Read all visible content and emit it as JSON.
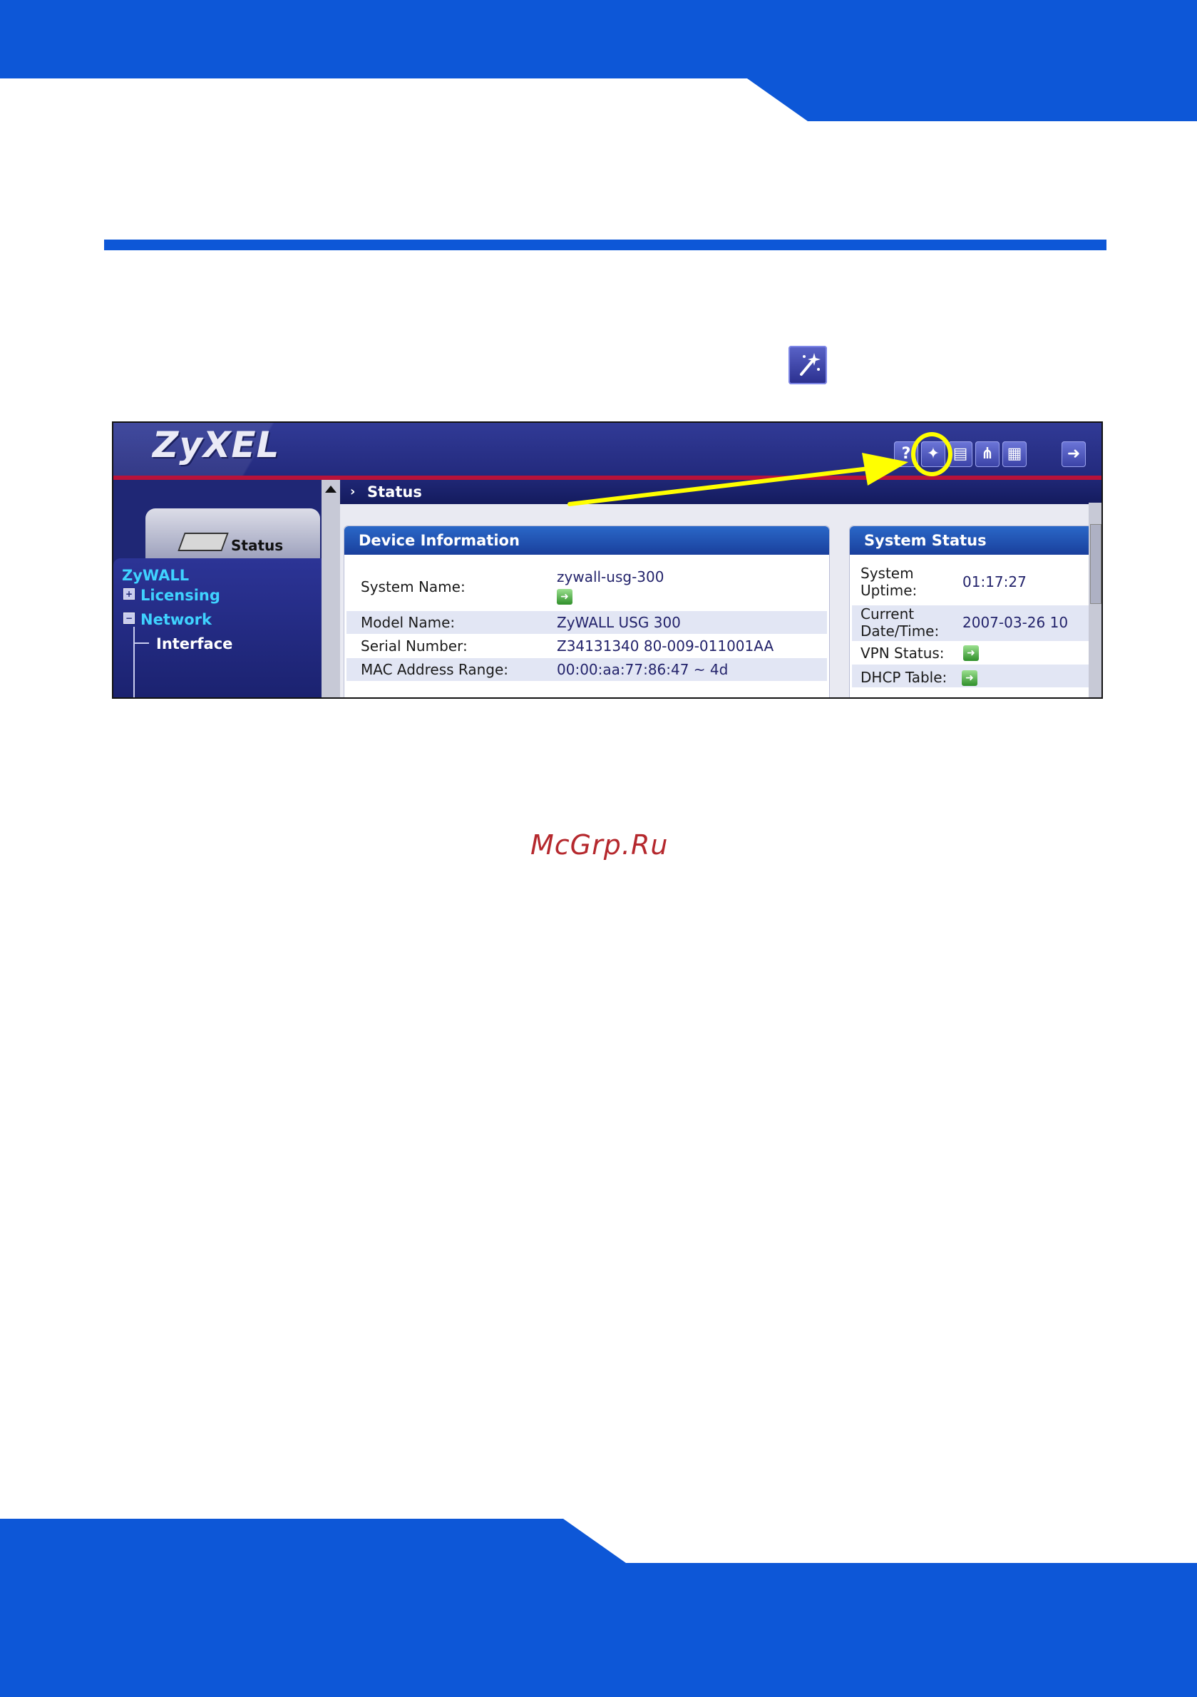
{
  "page": {
    "accent_color": "#0d57d7",
    "watermark": "McGrp.Ru"
  },
  "screen": {
    "logo": "ZyXEL",
    "toolbar": [
      {
        "name": "help-icon",
        "glyph": "?"
      },
      {
        "name": "wizard-icon",
        "glyph": "✦"
      },
      {
        "name": "console-icon",
        "glyph": "▤"
      },
      {
        "name": "topology-icon",
        "glyph": "⋔"
      },
      {
        "name": "notes-icon",
        "glyph": "▦"
      },
      {
        "name": "logout-icon",
        "glyph": "➜"
      }
    ],
    "nav": {
      "tab_label": "Status",
      "root": "ZyWALL",
      "items": [
        "Licensing",
        "Network",
        "Interface"
      ],
      "link_color": "#3fd2ff"
    },
    "breadcrumb": "Status",
    "device_info": {
      "title": "Device Information",
      "rows": [
        {
          "label": "System Name:",
          "value": "zywall-usg-300"
        },
        {
          "label": "Model Name:",
          "value": "ZyWALL USG 300"
        },
        {
          "label": "Serial Number:",
          "value": "Z34131340 80-009-011001AA"
        },
        {
          "label": "MAC Address Range:",
          "value": "00:00:aa:77:86:47 ~ 4d"
        }
      ]
    },
    "system_status": {
      "title": "System Status",
      "uptime_label_1": "System",
      "uptime_label_2": "Uptime:",
      "uptime_value": "01:17:27",
      "datetime_label_1": "Current",
      "datetime_label_2": "Date/Time:",
      "datetime_value": "2007-03-26 10",
      "vpn_label": "VPN Status:",
      "dhcp_label": "DHCP Table:"
    }
  }
}
